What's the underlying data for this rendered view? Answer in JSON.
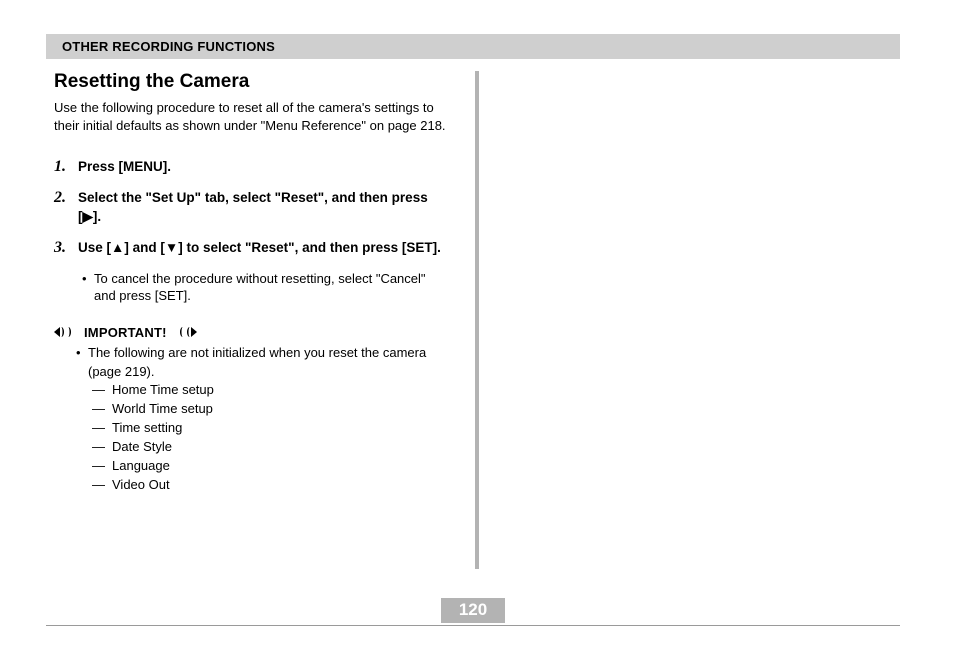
{
  "header": {
    "title": "OTHER RECORDING FUNCTIONS"
  },
  "section": {
    "title": "Resetting the Camera",
    "intro": "Use the following procedure to reset all of the camera's settings to their initial defaults as shown under \"Menu Reference\" on page 218."
  },
  "steps": [
    {
      "num": "1.",
      "text": "Press [MENU]."
    },
    {
      "num": "2.",
      "text": "Select the \"Set Up\" tab, select \"Reset\", and then press [▶]."
    },
    {
      "num": "3.",
      "text": "Use [▲] and [▼] to select \"Reset\", and then press [SET]."
    }
  ],
  "step3_sub": "To cancel the procedure without resetting, select \"Cancel\" and press [SET].",
  "important": {
    "label": "IMPORTANT!",
    "lead": "The following are not initialized when you reset the camera (page 219).",
    "items": [
      "Home Time setup",
      "World Time setup",
      "Time setting",
      "Date Style",
      "Language",
      "Video Out"
    ]
  },
  "glyphs": {
    "bullet": "•",
    "dash": "—"
  },
  "page_number": "120"
}
